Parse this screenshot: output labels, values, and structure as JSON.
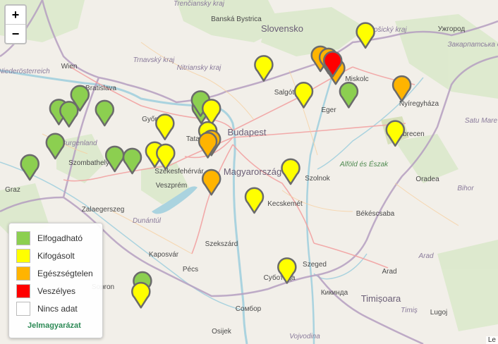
{
  "zoom": {
    "in_label": "+",
    "out_label": "−"
  },
  "legend": {
    "items": [
      {
        "label": "Elfogadható",
        "color": "#8ccf50"
      },
      {
        "label": "Kifogásolt",
        "color": "#ffff00"
      },
      {
        "label": "Egészségtelen",
        "color": "#ffb400"
      },
      {
        "label": "Veszélyes",
        "color": "#ff0000"
      },
      {
        "label": "Nincs adat",
        "color": "#ffffff"
      }
    ],
    "link_label": "Jelmagyarázat"
  },
  "attribution": "Le",
  "map_labels": {
    "countries": [
      "Slovensko",
      "Magyarország"
    ],
    "cities": [
      "Banská Bystrica",
      "Wien",
      "Bratislava",
      "Győr",
      "Salgótarján",
      "Eger",
      "Miskolc",
      "Nyíregyháza",
      "Debrecen",
      "Szolnok",
      "Kecskemét",
      "Szeged",
      "Békéscsaba",
      "Arad",
      "Timișoara",
      "Oradea",
      "Pécs",
      "Kaposvár",
      "Szekszárd",
      "Zalaegerszeg",
      "Szombathely",
      "Veszprém",
      "Székesfehérvár",
      "Tatabánya",
      "Budapest",
      "Graz",
      "Ужгород",
      "Osijek",
      "Сомбор",
      "Суботица",
      "Кикинда",
      "Lugoj",
      "Sopron"
    ],
    "regions": [
      "Trenčiansky kraj",
      "Trnavský kraj",
      "Nitriansky kraj",
      "Košický kraj",
      "Niederösterreich",
      "Burgenland",
      "Dunántúl",
      "Alföld és Észak",
      "Bihor",
      "Arad",
      "Timiș",
      "Satu Mare",
      "Закарпатська область",
      "Vojvodina"
    ],
    "water": [
      "Dunántúl"
    ]
  },
  "stations": [
    {
      "status": "Elfogadható",
      "color": "#8ccf50",
      "lon_lat": [
        17.63,
        47.73
      ]
    },
    {
      "status": "Elfogadható",
      "color": "#8ccf50",
      "lon_lat": [
        17.29,
        47.87
      ]
    },
    {
      "status": "Elfogadható",
      "color": "#8ccf50",
      "lon_lat": [
        17.0,
        47.74
      ]
    },
    {
      "status": "Elfogadható",
      "color": "#8ccf50",
      "lon_lat": [
        17.14,
        47.72
      ]
    },
    {
      "status": "Elfogadható",
      "color": "#8ccf50",
      "lon_lat": [
        16.95,
        47.42
      ]
    },
    {
      "status": "Elfogadható",
      "color": "#8ccf50",
      "lon_lat": [
        16.6,
        47.22
      ]
    },
    {
      "status": "Elfogadható",
      "color": "#8ccf50",
      "lon_lat": [
        17.77,
        47.3
      ]
    },
    {
      "status": "Elfogadható",
      "color": "#8ccf50",
      "lon_lat": [
        18.01,
        47.28
      ]
    },
    {
      "status": "Elfogadható",
      "color": "#8ccf50",
      "lon_lat": [
        18.96,
        47.75
      ]
    },
    {
      "status": "Elfogadható",
      "color": "#8ccf50",
      "lon_lat": [
        18.95,
        47.82
      ]
    },
    {
      "status": "Elfogadható",
      "color": "#8ccf50",
      "lon_lat": [
        20.99,
        47.9
      ]
    },
    {
      "status": "Elfogadható",
      "color": "#8ccf50",
      "lon_lat": [
        18.15,
        46.12
      ]
    },
    {
      "status": "Kifogásolt",
      "color": "#ffff00",
      "lon_lat": [
        21.22,
        48.46
      ]
    },
    {
      "status": "Kifogásolt",
      "color": "#ffff00",
      "lon_lat": [
        19.82,
        48.15
      ]
    },
    {
      "status": "Kifogásolt",
      "color": "#ffff00",
      "lon_lat": [
        20.37,
        47.9
      ]
    },
    {
      "status": "Kifogásolt",
      "color": "#ffff00",
      "lon_lat": [
        19.1,
        47.74
      ]
    },
    {
      "status": "Kifogásolt",
      "color": "#ffff00",
      "lon_lat": [
        18.46,
        47.6
      ]
    },
    {
      "status": "Kifogásolt",
      "color": "#ffff00",
      "lon_lat": [
        19.05,
        47.53
      ]
    },
    {
      "status": "Kifogásolt",
      "color": "#ffff00",
      "lon_lat": [
        18.32,
        47.34
      ]
    },
    {
      "status": "Kifogásolt",
      "color": "#ffff00",
      "lon_lat": [
        18.47,
        47.32
      ]
    },
    {
      "status": "Kifogásolt",
      "color": "#ffff00",
      "lon_lat": [
        20.19,
        47.18
      ]
    },
    {
      "status": "Kifogásolt",
      "color": "#ffff00",
      "lon_lat": [
        19.69,
        46.91
      ]
    },
    {
      "status": "Kifogásolt",
      "color": "#ffff00",
      "lon_lat": [
        21.63,
        47.54
      ]
    },
    {
      "status": "Kifogásolt",
      "color": "#ffff00",
      "lon_lat": [
        20.14,
        46.25
      ]
    },
    {
      "status": "Kifogásolt",
      "color": "#ffff00",
      "lon_lat": [
        18.13,
        46.02
      ]
    },
    {
      "status": "Egészségtelen",
      "color": "#ffb400",
      "lon_lat": [
        20.6,
        48.24
      ]
    },
    {
      "status": "Egészségtelen",
      "color": "#ffb400",
      "lon_lat": [
        20.71,
        48.22
      ]
    },
    {
      "status": "Egészségtelen",
      "color": "#ffb400",
      "lon_lat": [
        20.81,
        48.12
      ]
    },
    {
      "status": "Egészségtelen",
      "color": "#ffb400",
      "lon_lat": [
        21.72,
        47.96
      ]
    },
    {
      "status": "Egészségtelen",
      "color": "#ffb400",
      "lon_lat": [
        19.1,
        47.45
      ]
    },
    {
      "status": "Egészségtelen",
      "color": "#ffb400",
      "lon_lat": [
        19.05,
        47.43
      ]
    },
    {
      "status": "Egészségtelen",
      "color": "#ffb400",
      "lon_lat": [
        19.1,
        47.08
      ]
    },
    {
      "status": "Veszélyes",
      "color": "#ff0000",
      "lon_lat": [
        20.77,
        48.19
      ]
    }
  ]
}
